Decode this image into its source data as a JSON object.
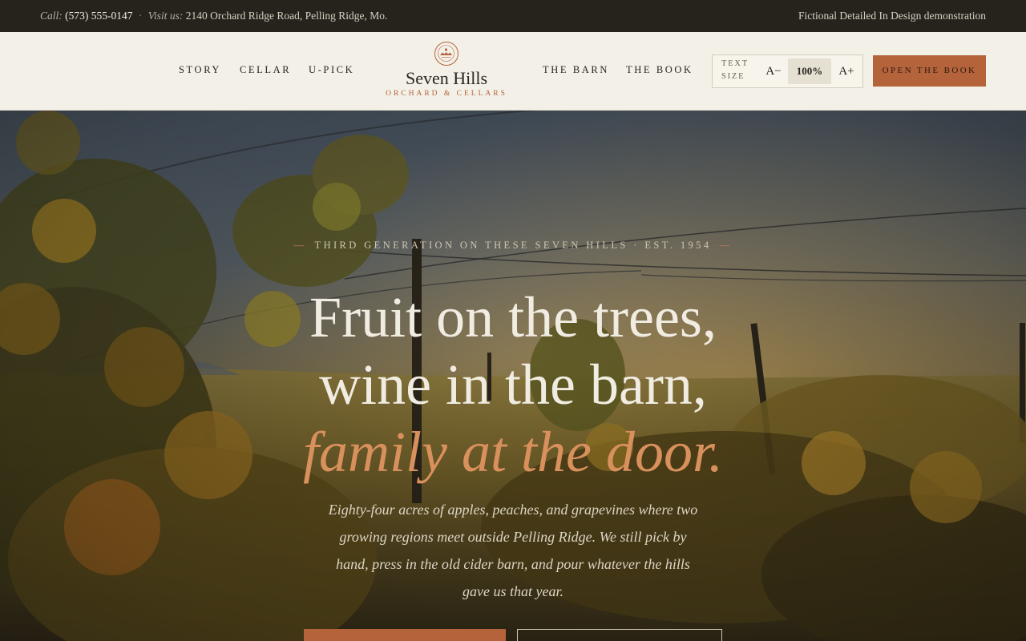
{
  "topbar": {
    "call_label": "Call:",
    "phone": "(573) 555-0147",
    "visit_label": "Visit us:",
    "address": "2140 Orchard Ridge Road, Pelling Ridge, Mo.",
    "note": "Fictional Detailed In Design demonstration"
  },
  "nav": {
    "left": [
      "Story",
      "Cellar",
      "U-Pick"
    ],
    "right": [
      "The Barn",
      "The Book"
    ]
  },
  "logo": {
    "name": "Seven Hills",
    "tagline": "Orchard & Cellars"
  },
  "text_size": {
    "label": "Text size",
    "decrease": "A−",
    "value": "100%",
    "increase": "A+"
  },
  "cta_top": "Open the Book",
  "hero": {
    "eyebrow": "Third generation on these seven hills · Est. 1954",
    "headline_1": "Fruit on the trees,",
    "headline_2": "wine in the barn,",
    "headline_3": "family at the door.",
    "lede": "Eighty-four acres of apples, peaches, and grapevines where two growing regions meet outside Pelling Ridge. We still pick by hand, press in the old cider barn, and pour whatever the hills gave us that year."
  },
  "colors": {
    "accent": "#b5633a",
    "accent_light": "#d8905c",
    "header_bg": "#f3f0e8",
    "topbar_bg": "#26231d",
    "ink": "#2b261f"
  }
}
